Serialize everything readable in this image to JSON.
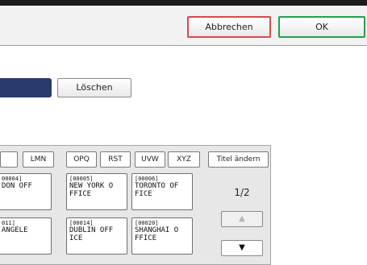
{
  "header": {
    "cancel_label": "Abbrechen",
    "ok_label": "OK"
  },
  "form": {
    "delete_label": "Löschen"
  },
  "tabs": [
    {
      "label": "LMN"
    },
    {
      "label": "OPQ"
    },
    {
      "label": "RST"
    },
    {
      "label": "UVW"
    },
    {
      "label": "XYZ"
    },
    {
      "label": "Titel ändern"
    }
  ],
  "entries": [
    {
      "code": "00004]",
      "line1": "DON OFF",
      "line2": ""
    },
    {
      "code": "[00005]",
      "line1": "NEW YORK O",
      "line2": "FFICE"
    },
    {
      "code": "[00006]",
      "line1": "TORONTO OF",
      "line2": "FICE"
    },
    {
      "code": "011]",
      "line1": "ANGELE",
      "line2": ""
    },
    {
      "code": "[00014]",
      "line1": "DUBLIN OFF",
      "line2": "ICE"
    },
    {
      "code": "[00020]",
      "line1": "SHANGHAI O",
      "line2": "FFICE"
    }
  ],
  "pager": {
    "indicator": "1/2",
    "up_glyph": "▲",
    "down_glyph": "▼"
  },
  "colors": {
    "cancel_border": "#d64a4a",
    "ok_border": "#1fa34a",
    "name_field_fill": "#2a3a6b"
  }
}
